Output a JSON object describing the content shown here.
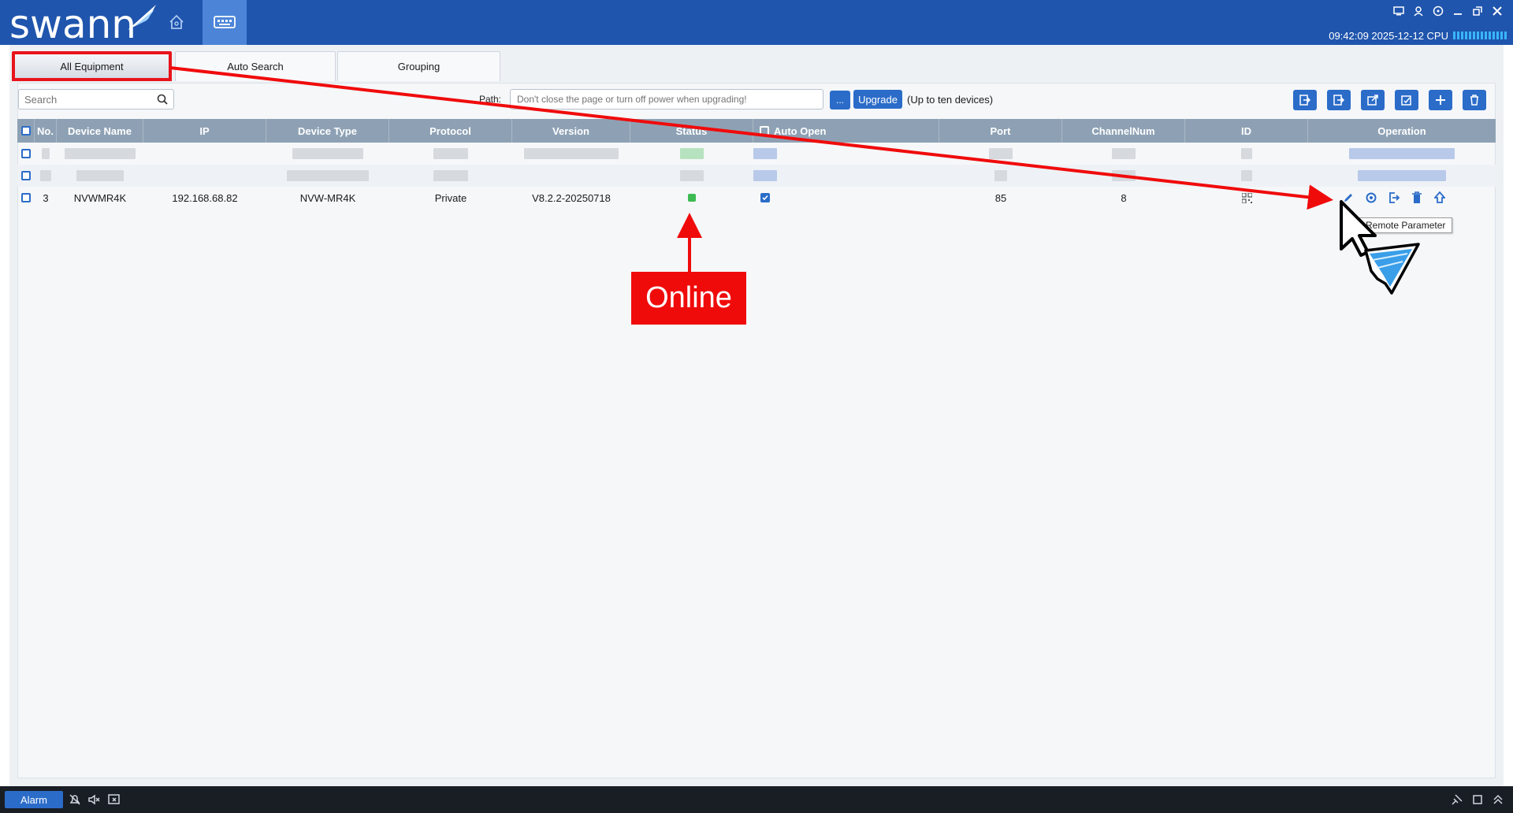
{
  "app": {
    "logo_text": "swann",
    "clock": "09:42:09 2025-12-12 CPU"
  },
  "colors": {
    "titlebar": "#1f55ad",
    "accent": "#2b6cc9",
    "online": "#3dbb52",
    "annotation_red": "#f00b0b"
  },
  "tabs": [
    {
      "label": "All Equipment",
      "active": true
    },
    {
      "label": "Auto Search",
      "active": false
    },
    {
      "label": "Grouping",
      "active": false
    }
  ],
  "toolbar": {
    "search_placeholder": "Search",
    "path_label": "Path:",
    "path_placeholder": "Don't close the page or turn off power when upgrading!",
    "browse_label": "...",
    "upgrade_label": "Upgrade",
    "upgrade_note": "(Up to ten devices)",
    "right_buttons": [
      "import-icon",
      "export-icon",
      "open-external-icon",
      "edit-check-icon",
      "add-icon",
      "delete-icon"
    ]
  },
  "table": {
    "columns": [
      "No.",
      "Device Name",
      "IP",
      "Device Type",
      "Protocol",
      "Version",
      "Status",
      "Auto Open",
      "Port",
      "ChannelNum",
      "ID",
      "Operation"
    ],
    "rows": [
      {
        "no": "3",
        "device_name": "NVWMR4K",
        "ip": "192.168.68.82",
        "device_type": "NVW-MR4K",
        "protocol": "Private",
        "version": "V8.2.2-20250718",
        "status": "online",
        "auto_open": true,
        "port": "85",
        "channel_num": "8",
        "id_icon": "qr-code-icon"
      }
    ],
    "operation_icons": [
      "edit-icon",
      "remote-parameter-icon",
      "logout-icon",
      "trash-icon",
      "upgrade-icon"
    ]
  },
  "tooltip": "Remote Parameter",
  "annotation": {
    "label": "Online"
  },
  "statusbar": {
    "alarm_label": "Alarm"
  }
}
